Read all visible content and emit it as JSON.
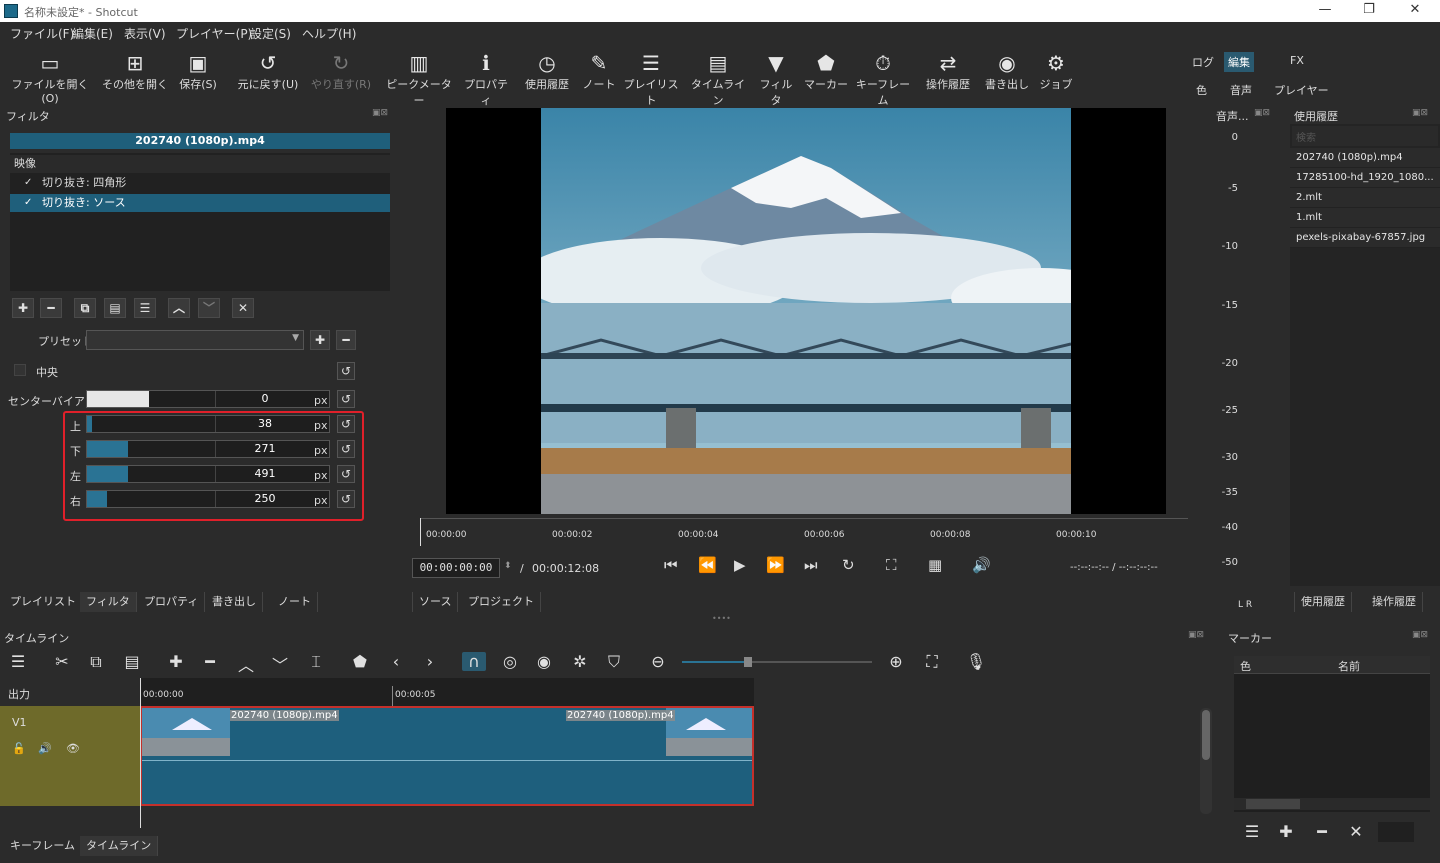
{
  "window": {
    "title": "名称未設定* - Shotcut",
    "min": "—",
    "max": "❐",
    "close": "✕"
  },
  "menu": [
    "ファイル(F)",
    "編集(E)",
    "表示(V)",
    "プレイヤー(P)",
    "設定(S)",
    "ヘルプ(H)"
  ],
  "toolbar": {
    "open": "ファイルを開く(O)",
    "open_other": "その他を開く",
    "save": "保存(S)",
    "undo": "元に戻す(U)",
    "redo": "やり直す(R)",
    "peak": "ピークメーター",
    "props": "プロパティ",
    "recent": "使用履歴",
    "notes": "ノート",
    "playlist": "プレイリスト",
    "timeline": "タイムライン",
    "filters": "フィルタ",
    "markers": "マーカー",
    "keyframes": "キーフレーム",
    "history": "操作履歴",
    "export": "書き出し",
    "jobs": "ジョブ"
  },
  "modes": {
    "log": "ログ",
    "edit": "編集",
    "fx": "FX",
    "color": "色",
    "audio": "音声",
    "player": "プレイヤー"
  },
  "filters_panel": {
    "title": "フィルタ",
    "clip": "202740 (1080p).mp4",
    "section": "映像",
    "items": [
      {
        "label": "切り抜き: 四角形",
        "check": "✓"
      },
      {
        "label": "切り抜き: ソース",
        "check": "✓"
      }
    ],
    "preset_label": "プリセット",
    "center_label": "中央",
    "bias_label": "センターバイアス",
    "bias_value": "0",
    "unit": "px",
    "params": [
      {
        "label": "上",
        "value": "38",
        "fill": 0.02
      },
      {
        "label": "下",
        "value": "271",
        "fill": 0.17
      },
      {
        "label": "左",
        "value": "491",
        "fill": 0.17
      },
      {
        "label": "右",
        "value": "250",
        "fill": 0.08
      }
    ]
  },
  "left_tabs": [
    "プレイリスト",
    "フィルタ",
    "プロパティ",
    "書き出し",
    "ノート"
  ],
  "player": {
    "ticks": [
      "00:00:00",
      "00:00:02",
      "00:00:04",
      "00:00:06",
      "00:00:08",
      "00:00:10"
    ],
    "timecode": "00:00:00:00",
    "duration": "00:00:12:08",
    "in_out": "--:--:--:-- / --:--:--:--",
    "tabs": [
      "ソース",
      "プロジェクト"
    ]
  },
  "audio_meter": {
    "title": "音声...",
    "levels": [
      "0",
      "-5",
      "-10",
      "-15",
      "-20",
      "-25",
      "-30",
      "-35",
      "-40",
      "-50"
    ],
    "lr": "L  R"
  },
  "recent_panel": {
    "title": "使用履歴",
    "search": "検索",
    "items": [
      "202740 (1080p).mp4",
      "17285100-hd_1920_1080...",
      "2.mlt",
      "1.mlt",
      "pexels-pixabay-67857.jpg"
    ],
    "tabs": [
      "使用履歴",
      "操作履歴"
    ]
  },
  "timeline": {
    "title": "タイムライン",
    "output": "出力",
    "track": "V1",
    "ruler": [
      "00:00:00",
      "00:00:05"
    ],
    "clip_name": "202740 (1080p).mp4"
  },
  "markers_panel": {
    "title": "マーカー",
    "col_color": "色",
    "col_name": "名前"
  },
  "bottom_tabs": [
    "キーフレーム",
    "タイムライン"
  ],
  "colors": {
    "accent": "#1f5f7b",
    "highlight_box": "#e0202a",
    "track_header": "#6e6a2a"
  }
}
